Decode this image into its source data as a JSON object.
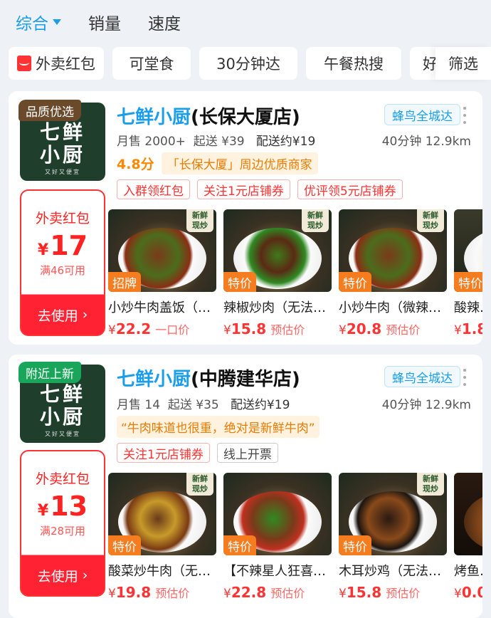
{
  "sort_bar": {
    "active": "综合",
    "items": [
      "销量",
      "速度"
    ]
  },
  "filters": {
    "chips": [
      "外卖红包",
      "可堂食",
      "30分钟达",
      "午餐热搜",
      "好"
    ],
    "screen": "筛选"
  },
  "shops": [
    {
      "corner_badge": "品质优选",
      "corner_color": "#6b4a2b",
      "logo": {
        "line1": "七鲜",
        "line2": "小厨",
        "slogan": "又好又便宜"
      },
      "coupon": {
        "title": "外卖红包",
        "currency": "¥",
        "amount": "17",
        "condition": "满46可用",
        "action": "去使用"
      },
      "name_brand": "七鲜小厨",
      "name_branch": "(长保大厦店)",
      "delivery_tag": "蜂鸟全城达",
      "sales": "月售 2000+",
      "min_order": "起送 ¥39",
      "delivery_fee": "配送约¥19",
      "time_distance": "40分钟  12.9km",
      "score": "4.8分",
      "highlight": "「长保大厦」周边优质商家",
      "promos": [
        "入群领红包",
        "关注1元店铺券",
        "优评领5元店铺券"
      ],
      "promos_gray": [],
      "dishes": [
        {
          "name": "小炒牛肉盖饭（…",
          "price": "22.2",
          "price_note": "一口价",
          "badge": "招牌"
        },
        {
          "name": "辣椒炒肉（无法…",
          "price": "15.8",
          "price_note": "预估价",
          "badge": "特价"
        },
        {
          "name": "小炒牛肉（微辣…",
          "price": "20.8",
          "price_note": "预估价",
          "badge": "特价"
        },
        {
          "name": "酸辣…",
          "price": "1.8",
          "price_note": "",
          "badge": "特价"
        }
      ]
    },
    {
      "corner_badge": "附近上新",
      "corner_color": "#19a65a",
      "logo": {
        "line1": "七鲜",
        "line2": "小厨",
        "slogan": "又好又便宜"
      },
      "coupon": {
        "title": "外卖红包",
        "currency": "¥",
        "amount": "13",
        "condition": "满28可用",
        "action": "去使用"
      },
      "name_brand": "七鲜小厨",
      "name_branch": "(中腾建华店)",
      "delivery_tag": "蜂鸟全城达",
      "sales": "月售 14",
      "min_order": "起送 ¥35",
      "delivery_fee": "配送约¥19",
      "time_distance": "40分钟  12.9km",
      "quote": "“牛肉味道也很重，绝对是新鲜牛肉”",
      "promos": [
        "关注1元店铺券"
      ],
      "promos_gray": [
        "线上开票"
      ],
      "dishes": [
        {
          "name": "酸菜炒牛肉（无…",
          "price": "19.8",
          "price_note": "预估价",
          "badge": "特价"
        },
        {
          "name": "【不辣星人狂喜…",
          "price": "22.8",
          "price_note": "预估价",
          "badge": "特价"
        },
        {
          "name": "木耳炒鸡（无法…",
          "price": "15.8",
          "price_note": "预估价",
          "badge": "特价"
        },
        {
          "name": "烤鱼…",
          "price": "0.0",
          "price_note": "",
          "badge": ""
        }
      ]
    }
  ],
  "dish_tag": {
    "line1": "新鲜",
    "line2": "现炒"
  },
  "colors": {
    "accent": "#1a9dea",
    "red": "#ff3333",
    "orange": "#f57c1f"
  }
}
